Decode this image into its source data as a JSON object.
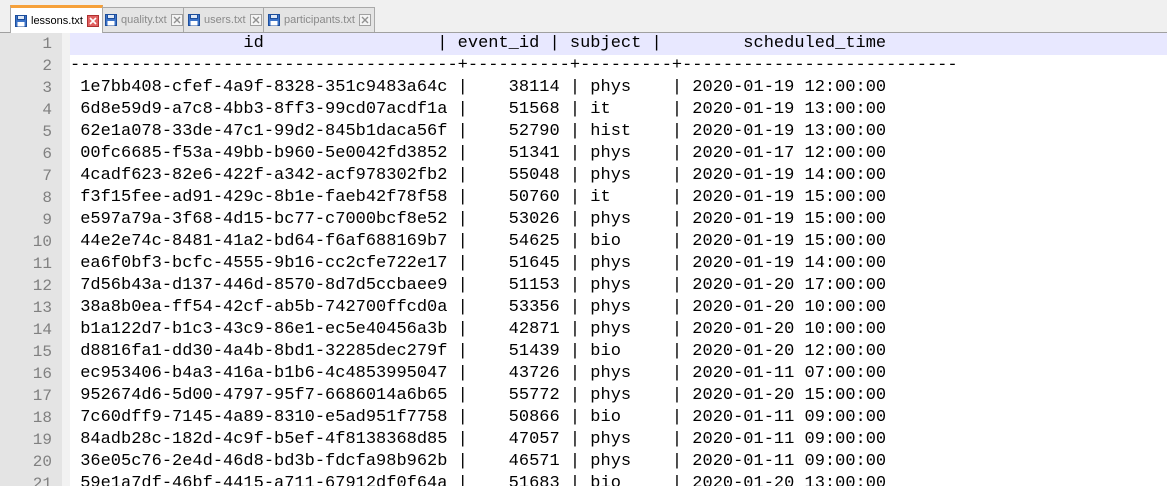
{
  "tabs": [
    {
      "label": "lessons.txt",
      "active": true
    },
    {
      "label": "quality.txt",
      "active": false
    },
    {
      "label": "users.txt",
      "active": false
    },
    {
      "label": "participants.txt",
      "active": false
    }
  ],
  "editor": {
    "lines": [
      {
        "num": "1",
        "text": "                 id                 | event_id | subject |        scheduled_time"
      },
      {
        "num": "2",
        "text": "--------------------------------------+----------+---------+---------------------------"
      },
      {
        "num": "3",
        "text": " 1e7bb408-cfef-4a9f-8328-351c9483a64c |    38114 | phys    | 2020-01-19 12:00:00"
      },
      {
        "num": "4",
        "text": " 6d8e59d9-a7c8-4bb3-8ff3-99cd07acdf1a |    51568 | it      | 2020-01-19 13:00:00"
      },
      {
        "num": "5",
        "text": " 62e1a078-33de-47c1-99d2-845b1daca56f |    52790 | hist    | 2020-01-19 13:00:00"
      },
      {
        "num": "6",
        "text": " 00fc6685-f53a-49bb-b960-5e0042fd3852 |    51341 | phys    | 2020-01-17 12:00:00"
      },
      {
        "num": "7",
        "text": " 4cadf623-82e6-422f-a342-acf978302fb2 |    55048 | phys    | 2020-01-19 14:00:00"
      },
      {
        "num": "8",
        "text": " f3f15fee-ad91-429c-8b1e-faeb42f78f58 |    50760 | it      | 2020-01-19 15:00:00"
      },
      {
        "num": "9",
        "text": " e597a79a-3f68-4d15-bc77-c7000bcf8e52 |    53026 | phys    | 2020-01-19 15:00:00"
      },
      {
        "num": "10",
        "text": " 44e2e74c-8481-41a2-bd64-f6af688169b7 |    54625 | bio     | 2020-01-19 15:00:00"
      },
      {
        "num": "11",
        "text": " ea6f0bf3-bcfc-4555-9b16-cc2cfe722e17 |    51645 | phys    | 2020-01-19 14:00:00"
      },
      {
        "num": "12",
        "text": " 7d56b43a-d137-446d-8570-8d7d5ccbaee9 |    51153 | phys    | 2020-01-20 17:00:00"
      },
      {
        "num": "13",
        "text": " 38a8b0ea-ff54-42cf-ab5b-742700ffcd0a |    53356 | phys    | 2020-01-20 10:00:00"
      },
      {
        "num": "14",
        "text": " b1a122d7-b1c3-43c9-86e1-ec5e40456a3b |    42871 | phys    | 2020-01-20 10:00:00"
      },
      {
        "num": "15",
        "text": " d8816fa1-dd30-4a4b-8bd1-32285dec279f |    51439 | bio     | 2020-01-20 12:00:00"
      },
      {
        "num": "16",
        "text": " ec953406-b4a3-416a-b1b6-4c4853995047 |    43726 | phys    | 2020-01-11 07:00:00"
      },
      {
        "num": "17",
        "text": " 952674d6-5d00-4797-95f7-6686014a6b65 |    55772 | phys    | 2020-01-20 15:00:00"
      },
      {
        "num": "18",
        "text": " 7c60dff9-7145-4a89-8310-e5ad951f7758 |    50866 | bio     | 2020-01-11 09:00:00"
      },
      {
        "num": "19",
        "text": " 84adb28c-182d-4c9f-b5ef-4f8138368d85 |    47057 | phys    | 2020-01-11 09:00:00"
      },
      {
        "num": "20",
        "text": " 36e05c76-2e4d-46d8-bd3b-fdcfa98b962b |    46571 | phys    | 2020-01-11 09:00:00"
      },
      {
        "num": "21",
        "text": " 59e1a7df-46bf-4415-a711-67912df0f64a |    51683 | bio     | 2020-01-20 13:00:00"
      }
    ]
  },
  "colors": {
    "active_tab_accent": "#f6a13b",
    "current_line_highlight": "#e8e8ff",
    "gutter_bg": "#e4e4e4",
    "line_number": "#808080"
  }
}
